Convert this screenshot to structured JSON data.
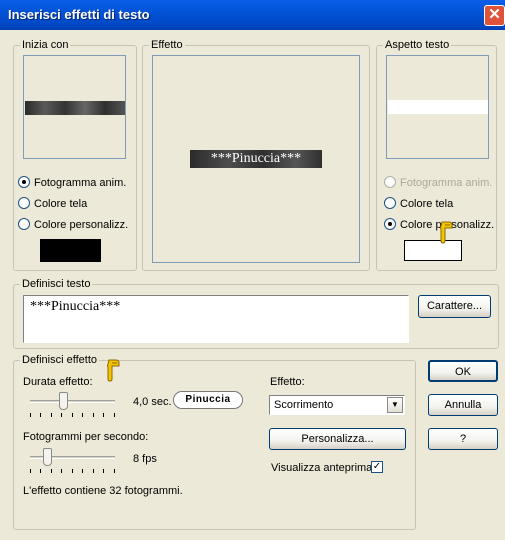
{
  "window": {
    "title": "Inserisci effetti di testo",
    "close": "✕"
  },
  "start": {
    "legend": "Inizia con",
    "options": [
      "Fotogramma anim.",
      "Colore tela",
      "Colore personalizz."
    ],
    "selected": 0
  },
  "effect_preview": {
    "legend": "Effetto",
    "preview_text": "***Pinuccia***"
  },
  "appearance": {
    "legend": "Aspetto testo",
    "options": [
      "Fotogramma anim.",
      "Colore tela",
      "Colore personalizz."
    ],
    "selected": 2
  },
  "text_def": {
    "legend": "Definisci testo",
    "value": "***Pinuccia***",
    "font_button": "Carattere..."
  },
  "effect_def": {
    "legend": "Definisci effetto",
    "duration_label": "Durata effetto:",
    "duration_value": "4,0 sec.",
    "duration_level": 0.4,
    "fps_label": "Fotogrammi per secondo:",
    "fps_value": "8 fps",
    "fps_level": 0.2,
    "frames_info": "L'effetto contiene 32 fotogrammi.",
    "effect_label": "Effetto:",
    "effect_value": "Scorrimento",
    "customize_button": "Personalizza...",
    "preview_label": "Visualizza anteprima",
    "preview_checked": true,
    "badge": "Pinuccia"
  },
  "buttons": {
    "ok": "OK",
    "cancel": "Annulla",
    "help": "?"
  },
  "colors": {
    "title_bar": "#0054e3",
    "dialog_bg": "#ece9d8",
    "pointer": "#f5c400"
  }
}
